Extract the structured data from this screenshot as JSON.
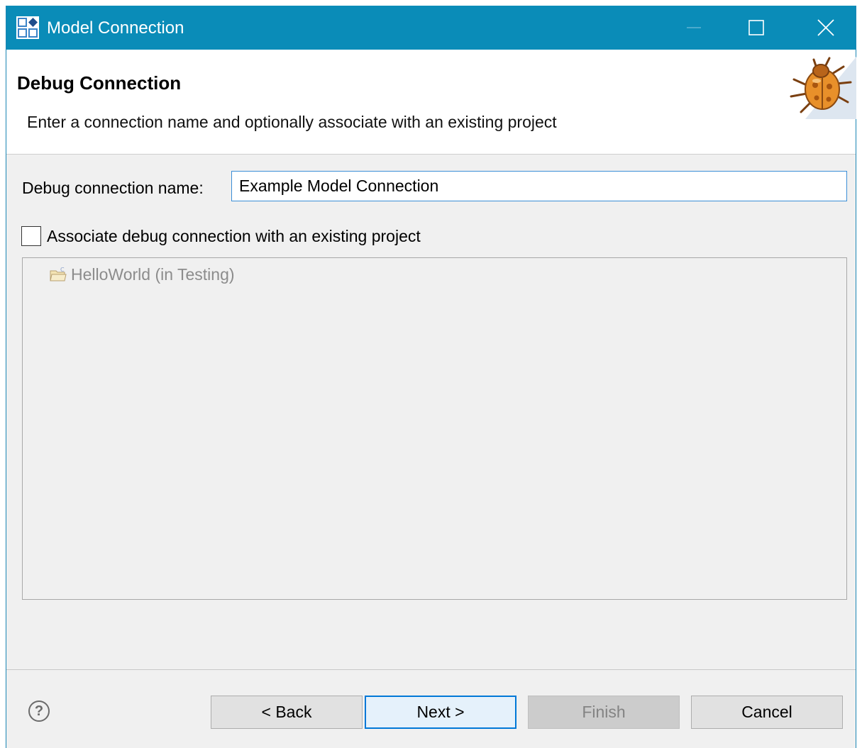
{
  "window": {
    "title": "Model Connection"
  },
  "header": {
    "title": "Debug Connection",
    "description": "Enter a connection name and optionally associate with an existing project"
  },
  "form": {
    "name_label": "Debug connection name:",
    "name_value": "Example Model Connection",
    "associate_label": "Associate debug connection with an existing project",
    "associate_checked": false
  },
  "projects": [
    {
      "label": "HelloWorld (in Testing)"
    }
  ],
  "buttons": {
    "help": "?",
    "back": "< Back",
    "next": "Next >",
    "finish": "Finish",
    "cancel": "Cancel"
  },
  "colors": {
    "titlebar": "#0a8cb8",
    "focus": "#0078d7",
    "disabled_text": "#838383"
  }
}
